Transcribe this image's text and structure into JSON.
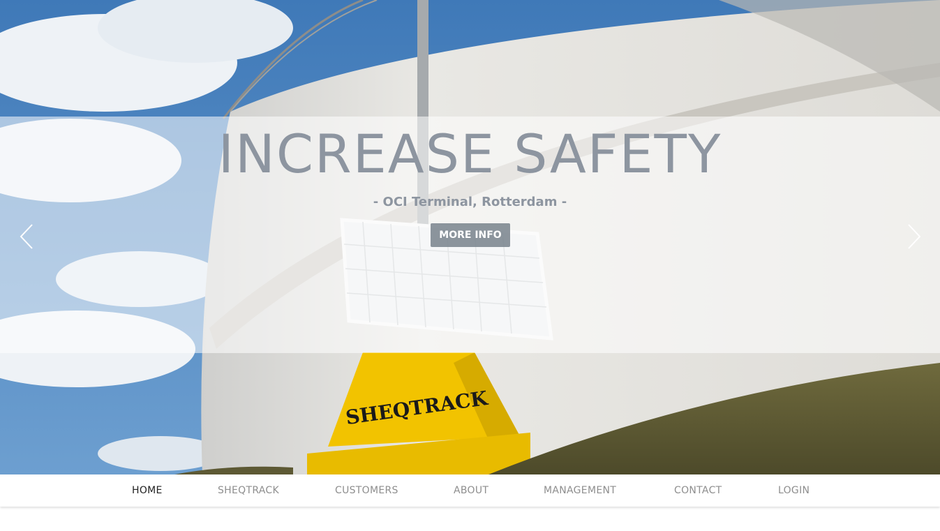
{
  "hero": {
    "headline": "INCREASE SAFETY",
    "subline": "- OCI Terminal, Rotterdam -",
    "button_label": "MORE INFO",
    "device_label": "SHEQTRACK"
  },
  "carousel": {
    "prev_icon": "chevron-left-icon",
    "next_icon": "chevron-right-icon"
  },
  "nav": {
    "items": [
      {
        "label": "HOME",
        "active": true
      },
      {
        "label": "SHEQTRACK"
      },
      {
        "label": "CUSTOMERS"
      },
      {
        "label": "ABOUT"
      },
      {
        "label": "MANAGEMENT"
      },
      {
        "label": "CONTACT"
      },
      {
        "label": "LOGIN"
      }
    ]
  },
  "colors": {
    "headline": "#8d95a0",
    "button_bg": "#78828c",
    "nav_active": "#222222",
    "nav_inactive": "#8e8e8e",
    "device_yellow": "#f2c300"
  }
}
